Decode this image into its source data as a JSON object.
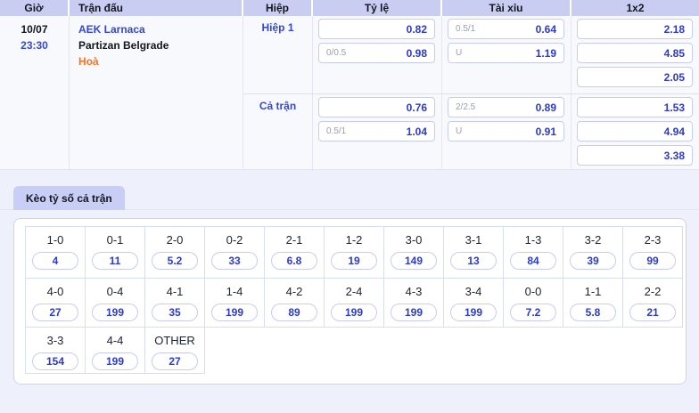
{
  "colors": {
    "value_blue": "#2b3ad1",
    "label_blue": "#3447d6",
    "draw_orange": "#ff6f1f",
    "header_bg": "#c8cdf1",
    "tab_bg": "#c9cef6"
  },
  "odds_table": {
    "headers": {
      "time": "Giờ",
      "match": "Trận đấu",
      "period": "Hiệp",
      "rate": "Tỷ lệ",
      "over_under": "Tài xỉu",
      "one_x_two": "1x2"
    },
    "match": {
      "date": "10/07",
      "time": "23:30",
      "home": "AEK Larnaca",
      "away": "Partizan Belgrade",
      "result": "Hoà"
    },
    "periods": [
      {
        "label": "Hiệp 1",
        "rate": [
          {
            "hcp": "",
            "odds": "0.82"
          },
          {
            "hcp": "0/0.5",
            "odds": "0.98"
          }
        ],
        "over_under": [
          {
            "hcp": "0.5/1",
            "odds": "0.64"
          },
          {
            "hcp": "U",
            "odds": "1.19"
          }
        ],
        "one_x_two": [
          "2.18",
          "4.85",
          "2.05"
        ]
      },
      {
        "label": "Cả trận",
        "rate": [
          {
            "hcp": "",
            "odds": "0.76"
          },
          {
            "hcp": "0.5/1",
            "odds": "1.04"
          }
        ],
        "over_under": [
          {
            "hcp": "2/2.5",
            "odds": "0.89"
          },
          {
            "hcp": "U",
            "odds": "0.91"
          }
        ],
        "one_x_two": [
          "1.53",
          "4.94",
          "3.38"
        ]
      }
    ]
  },
  "score_section": {
    "tab_label": "Kèo tỷ số cả trận",
    "rows": [
      {
        "cells": [
          {
            "score": "1-0",
            "odds": "4"
          },
          {
            "score": "0-1",
            "odds": "11"
          },
          {
            "score": "2-0",
            "odds": "5.2"
          },
          {
            "score": "0-2",
            "odds": "33"
          },
          {
            "score": "2-1",
            "odds": "6.8"
          },
          {
            "score": "1-2",
            "odds": "19"
          },
          {
            "score": "3-0",
            "odds": "149"
          },
          {
            "score": "3-1",
            "odds": "13"
          },
          {
            "score": "1-3",
            "odds": "84"
          },
          {
            "score": "3-2",
            "odds": "39"
          },
          {
            "score": "2-3",
            "odds": "99"
          }
        ]
      },
      {
        "cells": [
          {
            "score": "4-0",
            "odds": "27"
          },
          {
            "score": "0-4",
            "odds": "199"
          },
          {
            "score": "4-1",
            "odds": "35"
          },
          {
            "score": "1-4",
            "odds": "199"
          },
          {
            "score": "4-2",
            "odds": "89"
          },
          {
            "score": "2-4",
            "odds": "199"
          },
          {
            "score": "4-3",
            "odds": "199"
          },
          {
            "score": "3-4",
            "odds": "199"
          },
          {
            "score": "0-0",
            "odds": "7.2"
          },
          {
            "score": "1-1",
            "odds": "5.8"
          },
          {
            "score": "2-2",
            "odds": "21"
          }
        ]
      },
      {
        "cells": [
          {
            "score": "3-3",
            "odds": "154"
          },
          {
            "score": "4-4",
            "odds": "199"
          },
          {
            "score": "OTHER",
            "odds": "27"
          }
        ]
      }
    ]
  }
}
